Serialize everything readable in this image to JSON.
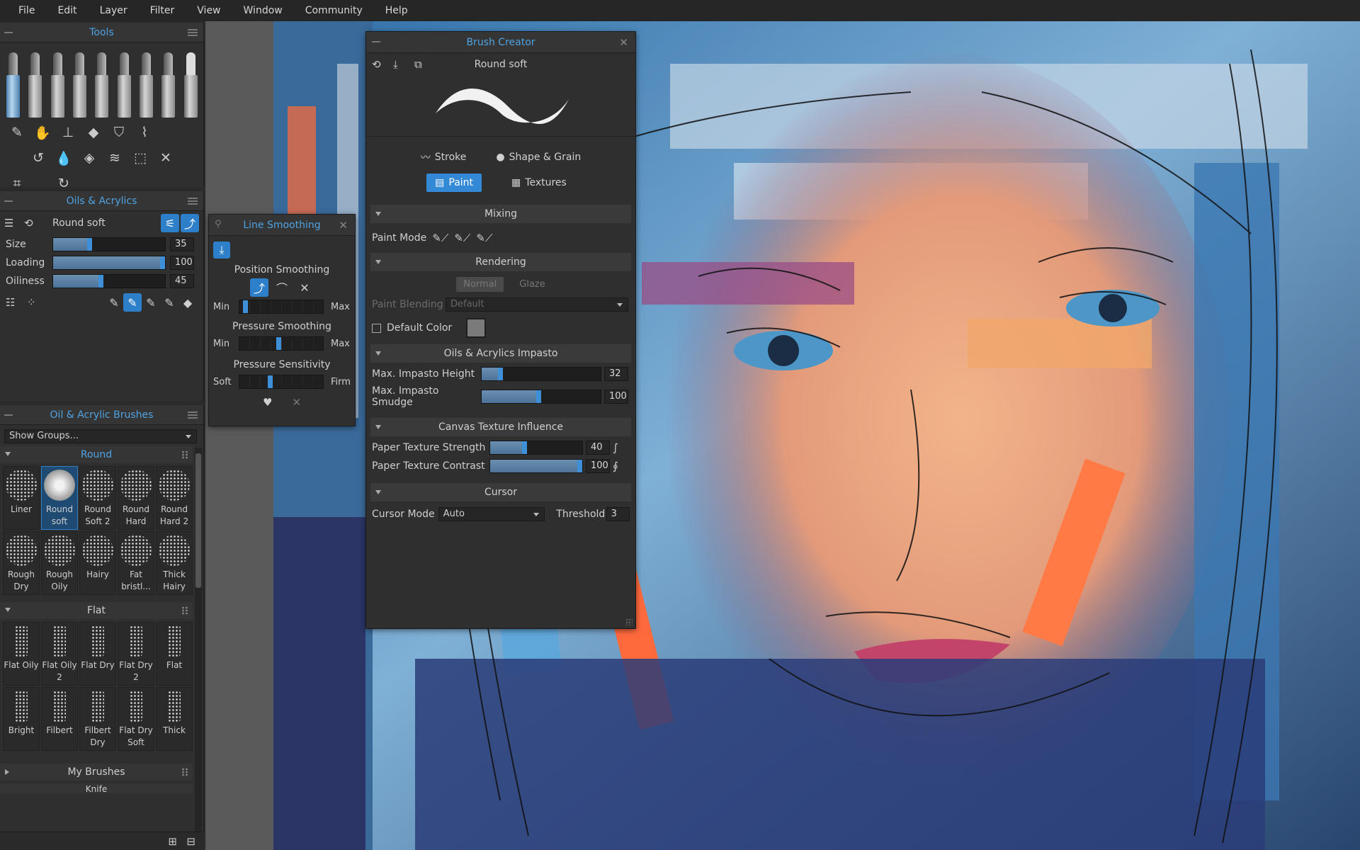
{
  "menu": [
    "File",
    "Edit",
    "Layer",
    "Filter",
    "View",
    "Window",
    "Community",
    "Help"
  ],
  "tools_panel": {
    "title": "Tools"
  },
  "oils_panel": {
    "title": "Oils & Acrylics",
    "brush_name": "Round soft",
    "sliders": [
      {
        "label": "Size",
        "value": "35",
        "level": 0.35
      },
      {
        "label": "Loading",
        "value": "100",
        "level": 1.0
      },
      {
        "label": "Oiliness",
        "value": "45",
        "level": 0.45
      }
    ]
  },
  "line_smoothing": {
    "title": "Line Smoothing",
    "position_label": "Position Smoothing",
    "pressure_label": "Pressure Smoothing",
    "sensitivity_label": "Pressure Sensitivity",
    "min": "Min",
    "max": "Max",
    "soft": "Soft",
    "firm": "Firm",
    "position_level": 0.1,
    "pressure_level": 0.5,
    "sensitivity_level": 0.4
  },
  "brushes_panel": {
    "title": "Oil & Acrylic Brushes",
    "dropdown": "Show Groups...",
    "groups": [
      {
        "name": "Round",
        "items": [
          "Liner",
          "Round soft",
          "Round Soft 2",
          "Round Hard",
          "Round Hard 2",
          "Rough Dry",
          "Rough Oily",
          "Hairy",
          "Fat bristl...",
          "Thick Hairy"
        ]
      },
      {
        "name": "Flat",
        "items": [
          "Flat Oily",
          "Flat Oily 2",
          "Flat Dry",
          "Flat Dry 2",
          "Flat",
          "Bright",
          "Filbert",
          "Filbert Dry",
          "Flat Dry Soft",
          "Thick"
        ]
      }
    ],
    "my_brushes": "My Brushes",
    "knife": "Knife"
  },
  "brush_creator": {
    "title": "Brush Creator",
    "brush_name": "Round soft",
    "tabs": [
      "Stroke",
      "Shape & Grain",
      "Paint",
      "Textures"
    ],
    "active_tab": "Paint",
    "mixing": "Mixing",
    "paint_mode": "Paint Mode",
    "rendering": "Rendering",
    "normal": "Normal",
    "glaze": "Glaze",
    "paint_blending": "Paint Blending",
    "blending_value": "Default",
    "default_color": "Default Color",
    "impasto": "Oils & Acrylics Impasto",
    "impasto_height": {
      "label": "Max. Impasto Height",
      "value": "32",
      "level": 0.18
    },
    "impasto_smudge": {
      "label": "Max. Impasto Smudge",
      "value": "100",
      "level": 0.5
    },
    "canvas_texture": "Canvas Texture Influence",
    "paper_strength": {
      "label": "Paper Texture Strength",
      "value": "40",
      "level": 0.4
    },
    "paper_contrast": {
      "label": "Paper Texture Contrast",
      "value": "100",
      "level": 1.0
    },
    "cursor": "Cursor",
    "cursor_mode": "Cursor Mode",
    "cursor_value": "Auto",
    "threshold": "Threshold",
    "threshold_value": "3"
  },
  "colors": {
    "accent": "#3d8fd8",
    "title": "#4fa3e3",
    "panel": "#2f2f2f"
  }
}
